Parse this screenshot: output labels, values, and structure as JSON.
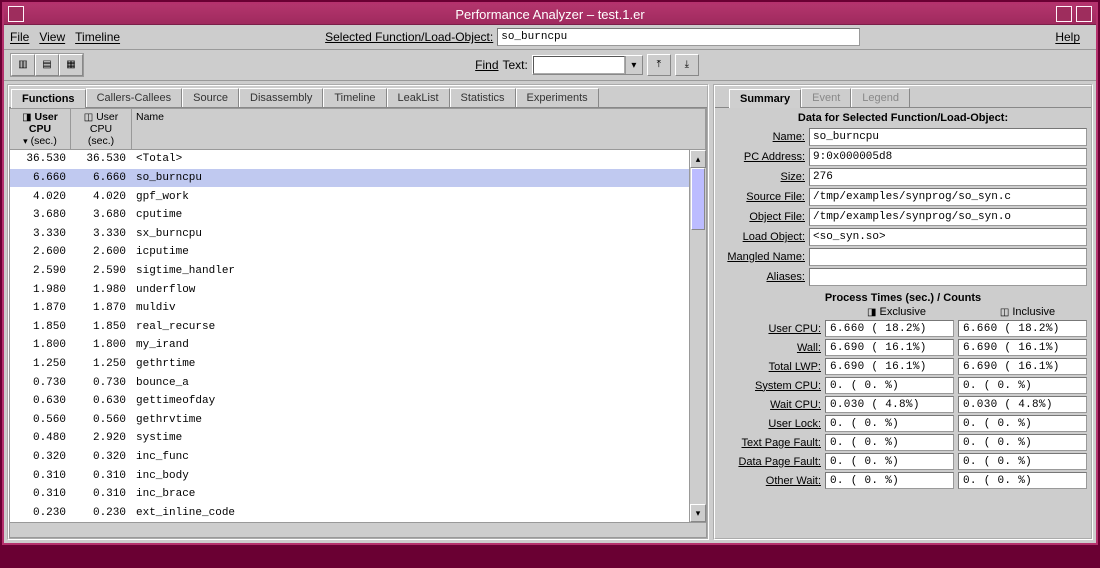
{
  "window": {
    "title": "Performance Analyzer – test.1.er"
  },
  "menu": {
    "file": "File",
    "view": "View",
    "timeline": "Timeline",
    "help": "Help"
  },
  "selected_function": {
    "label": "Selected Function/Load-Object:",
    "value": "so_burncpu"
  },
  "toolbar": {
    "find_label": "Find",
    "find_kind": "Text:"
  },
  "left_tabs": [
    "Functions",
    "Callers-Callees",
    "Source",
    "Disassembly",
    "Timeline",
    "LeakList",
    "Statistics",
    "Experiments"
  ],
  "left_tab_active": 0,
  "headers": {
    "metric1_line1": "User",
    "metric1_line2": "CPU",
    "metric1_line3": "(sec.)",
    "metric2_line1": "User",
    "metric2_line2": "CPU",
    "metric2_line3": "(sec.)",
    "name": "Name"
  },
  "rows": [
    {
      "m1": "36.530",
      "m2": "36.530",
      "name": "<Total>"
    },
    {
      "m1": "6.660",
      "m2": "6.660",
      "name": "so_burncpu",
      "selected": true
    },
    {
      "m1": "4.020",
      "m2": "4.020",
      "name": "gpf_work"
    },
    {
      "m1": "3.680",
      "m2": "3.680",
      "name": "cputime"
    },
    {
      "m1": "3.330",
      "m2": "3.330",
      "name": "sx_burncpu"
    },
    {
      "m1": "2.600",
      "m2": "2.600",
      "name": "icputime"
    },
    {
      "m1": "2.590",
      "m2": "2.590",
      "name": "sigtime_handler"
    },
    {
      "m1": "1.980",
      "m2": "1.980",
      "name": "underflow"
    },
    {
      "m1": "1.870",
      "m2": "1.870",
      "name": "muldiv"
    },
    {
      "m1": "1.850",
      "m2": "1.850",
      "name": "real_recurse"
    },
    {
      "m1": "1.800",
      "m2": "1.800",
      "name": "my_irand"
    },
    {
      "m1": "1.250",
      "m2": "1.250",
      "name": "gethrtime"
    },
    {
      "m1": "0.730",
      "m2": "0.730",
      "name": "bounce_a"
    },
    {
      "m1": "0.630",
      "m2": "0.630",
      "name": "gettimeofday"
    },
    {
      "m1": "0.560",
      "m2": "0.560",
      "name": "gethrvtime"
    },
    {
      "m1": "0.480",
      "m2": "2.920",
      "name": "systime"
    },
    {
      "m1": "0.320",
      "m2": "0.320",
      "name": "inc_func"
    },
    {
      "m1": "0.310",
      "m2": "0.310",
      "name": "inc_body"
    },
    {
      "m1": "0.310",
      "m2": "0.310",
      "name": "inc_brace"
    },
    {
      "m1": "0.230",
      "m2": "0.230",
      "name": "ext_inline_code"
    }
  ],
  "right_tabs": [
    "Summary",
    "Event",
    "Legend"
  ],
  "right_tab_active": 0,
  "summary": {
    "title": "Data for Selected Function/Load-Object:",
    "fields": {
      "Name": "so_burncpu",
      "PC Address": "9:0x000005d8",
      "Size": "276",
      "Source File": "/tmp/examples/synprog/so_syn.c",
      "Object File": "/tmp/examples/synprog/so_syn.o",
      "Load Object": "<so_syn.so>",
      "Mangled Name": "",
      "Aliases": ""
    }
  },
  "process_times": {
    "title": "Process Times (sec.) / Counts",
    "col1": "Exclusive",
    "col2": "Inclusive",
    "rows": [
      {
        "label": "User CPU:",
        "ex": "6.660 ( 18.2%)",
        "in": "6.660 ( 18.2%)"
      },
      {
        "label": "Wall:",
        "ex": "6.690 ( 16.1%)",
        "in": "6.690 ( 16.1%)"
      },
      {
        "label": "Total LWP:",
        "ex": "6.690 ( 16.1%)",
        "in": "6.690 ( 16.1%)"
      },
      {
        "label": "System CPU:",
        "ex": "0.    (  0. %)",
        "in": "0.    (  0. %)"
      },
      {
        "label": "Wait CPU:",
        "ex": "0.030 (  4.8%)",
        "in": "0.030 (  4.8%)"
      },
      {
        "label": "User Lock:",
        "ex": "0.    (  0. %)",
        "in": "0.    (  0. %)"
      },
      {
        "label": "Text Page Fault:",
        "ex": "0.    (  0. %)",
        "in": "0.    (  0. %)"
      },
      {
        "label": "Data Page Fault:",
        "ex": "0.    (  0. %)",
        "in": "0.    (  0. %)"
      },
      {
        "label": "Other Wait:",
        "ex": "0.    (  0. %)",
        "in": "0.    (  0. %)"
      }
    ]
  }
}
